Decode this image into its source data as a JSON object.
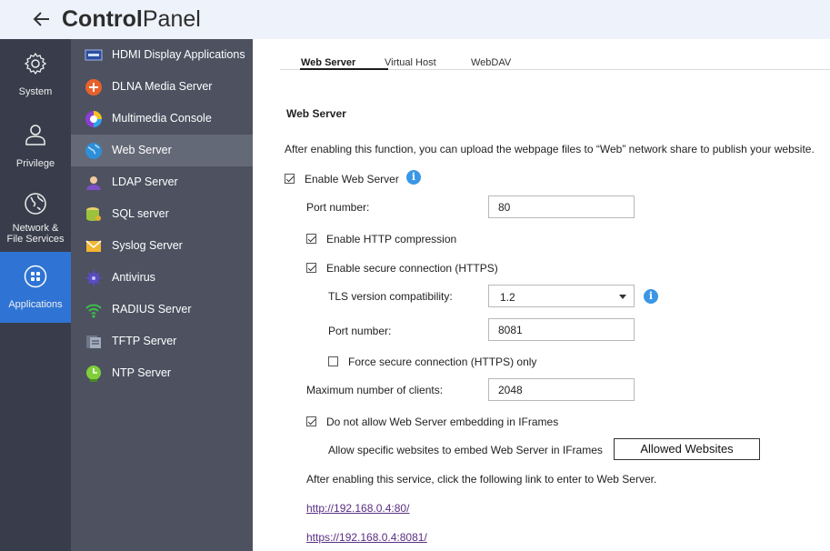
{
  "header": {
    "title_bold": "Control",
    "title_light": "Panel",
    "back_icon": "back-arrow-icon"
  },
  "leftnav": [
    {
      "label_lines": [
        "System"
      ],
      "icon": "gear-icon"
    },
    {
      "label_lines": [
        "Privilege"
      ],
      "icon": "user-icon"
    },
    {
      "label_lines": [
        "Network &",
        "File Services"
      ],
      "icon": "globe-icon"
    },
    {
      "label_lines": [
        "Applications"
      ],
      "icon": "grid-icon",
      "active": true
    }
  ],
  "sublist": [
    {
      "label": "HDMI Display Applications",
      "icon": "hdmi-icon"
    },
    {
      "label": "DLNA Media Server",
      "icon": "dlna-icon"
    },
    {
      "label": "Multimedia Console",
      "icon": "multimedia-icon"
    },
    {
      "label": "Web Server",
      "icon": "web-globe-icon",
      "active": true
    },
    {
      "label": "LDAP Server",
      "icon": "ldap-icon"
    },
    {
      "label": "SQL server",
      "icon": "database-icon"
    },
    {
      "label": "Syslog Server",
      "icon": "syslog-icon"
    },
    {
      "label": "Antivirus",
      "icon": "antivirus-icon"
    },
    {
      "label": "RADIUS Server",
      "icon": "radius-icon"
    },
    {
      "label": "TFTP Server",
      "icon": "tftp-icon"
    },
    {
      "label": "NTP Server",
      "icon": "ntp-clock-icon"
    }
  ],
  "tabs": [
    "Web Server",
    "Virtual Host",
    "WebDAV"
  ],
  "main": {
    "section_title": "Web Server",
    "description": "After enabling this function, you can upload the webpage files to “Web” network share to publish your website.",
    "enable_web_server": {
      "label": "Enable Web Server",
      "checked": true
    },
    "port_label": "Port number:",
    "port_value": "80",
    "http_compression": {
      "label": "Enable HTTP compression",
      "checked": true
    },
    "secure_connection": {
      "label": "Enable secure connection (HTTPS)",
      "checked": true
    },
    "tls_label": "TLS version compatibility:",
    "tls_value": "1.2",
    "https_port_label": "Port number:",
    "https_port_value": "8081",
    "force_https": {
      "label": "Force secure connection (HTTPS) only",
      "checked": false
    },
    "max_clients_label": "Maximum number of clients:",
    "max_clients_value": "2048",
    "no_iframes": {
      "label": "Do not allow Web Server embedding in IFrames",
      "checked": true
    },
    "allow_sites_label": "Allow specific websites to embed Web Server in IFrames",
    "allowed_websites_button": "Allowed Websites",
    "link_note": "After enabling this service, click the following link to enter to Web Server.",
    "http_link": "http://192.168.0.4:80/",
    "https_link": "https://192.168.0.4:8081/"
  },
  "colors": {
    "accent": "#2f74d4",
    "nav_bg": "#393d4b",
    "sublist_bg": "#4d5160",
    "header_bg": "#eef2fa",
    "info_blue": "#3b97e6",
    "link": "#5a2e84"
  }
}
